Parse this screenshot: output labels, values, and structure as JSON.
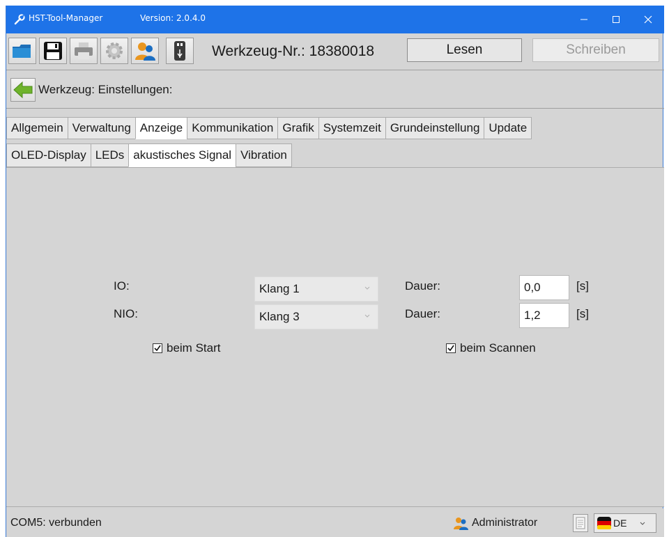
{
  "window": {
    "title": "HST-Tool-Manager",
    "version": "Version: 2.0.4.0",
    "controls": [
      "minimize-icon",
      "maximize-icon",
      "close-icon"
    ]
  },
  "toolbar": {
    "icons": [
      "open-folder-icon",
      "save-icon",
      "print-icon",
      "settings-gear-icon",
      "user-icon",
      "usb-device-icon"
    ],
    "tool_number": "Werkzeug-Nr.: 18380018",
    "read_label": "Lesen",
    "write_label": "Schreiben"
  },
  "breadcrumb": {
    "back_icon": "back-arrow-icon",
    "label": "Werkzeug: Einstellungen:"
  },
  "tabs": [
    {
      "label": "Allgemein",
      "active": false
    },
    {
      "label": "Verwaltung",
      "active": false
    },
    {
      "label": "Anzeige",
      "active": true
    },
    {
      "label": "Kommunikation",
      "active": false
    },
    {
      "label": "Grafik",
      "active": false
    },
    {
      "label": "Systemzeit",
      "active": false
    },
    {
      "label": "Grundeinstellung",
      "active": false
    },
    {
      "label": "Update",
      "active": false
    }
  ],
  "subtabs": [
    {
      "label": "OLED-Display",
      "active": false
    },
    {
      "label": "LEDs",
      "active": false
    },
    {
      "label": "akustisches Signal",
      "active": true
    },
    {
      "label": "Vibration",
      "active": false
    }
  ],
  "form": {
    "io": {
      "label": "IO:",
      "sound": "Klang 1",
      "duration_label": "Dauer:",
      "duration": "0,0",
      "unit": "[s]"
    },
    "nio": {
      "label": "NIO:",
      "sound": "Klang 3",
      "duration_label": "Dauer:",
      "duration": "1,2",
      "unit": "[s]"
    },
    "on_start": {
      "label": "beim Start",
      "checked": true
    },
    "on_scan": {
      "label": "beim Scannen",
      "checked": true
    }
  },
  "status": {
    "connection": "COM5: verbunden",
    "user": "Administrator",
    "language": "DE"
  },
  "colors": {
    "titlebar": "#1e73e8",
    "window_bg": "#d5d5d5",
    "active_tab": "#ffffff"
  }
}
